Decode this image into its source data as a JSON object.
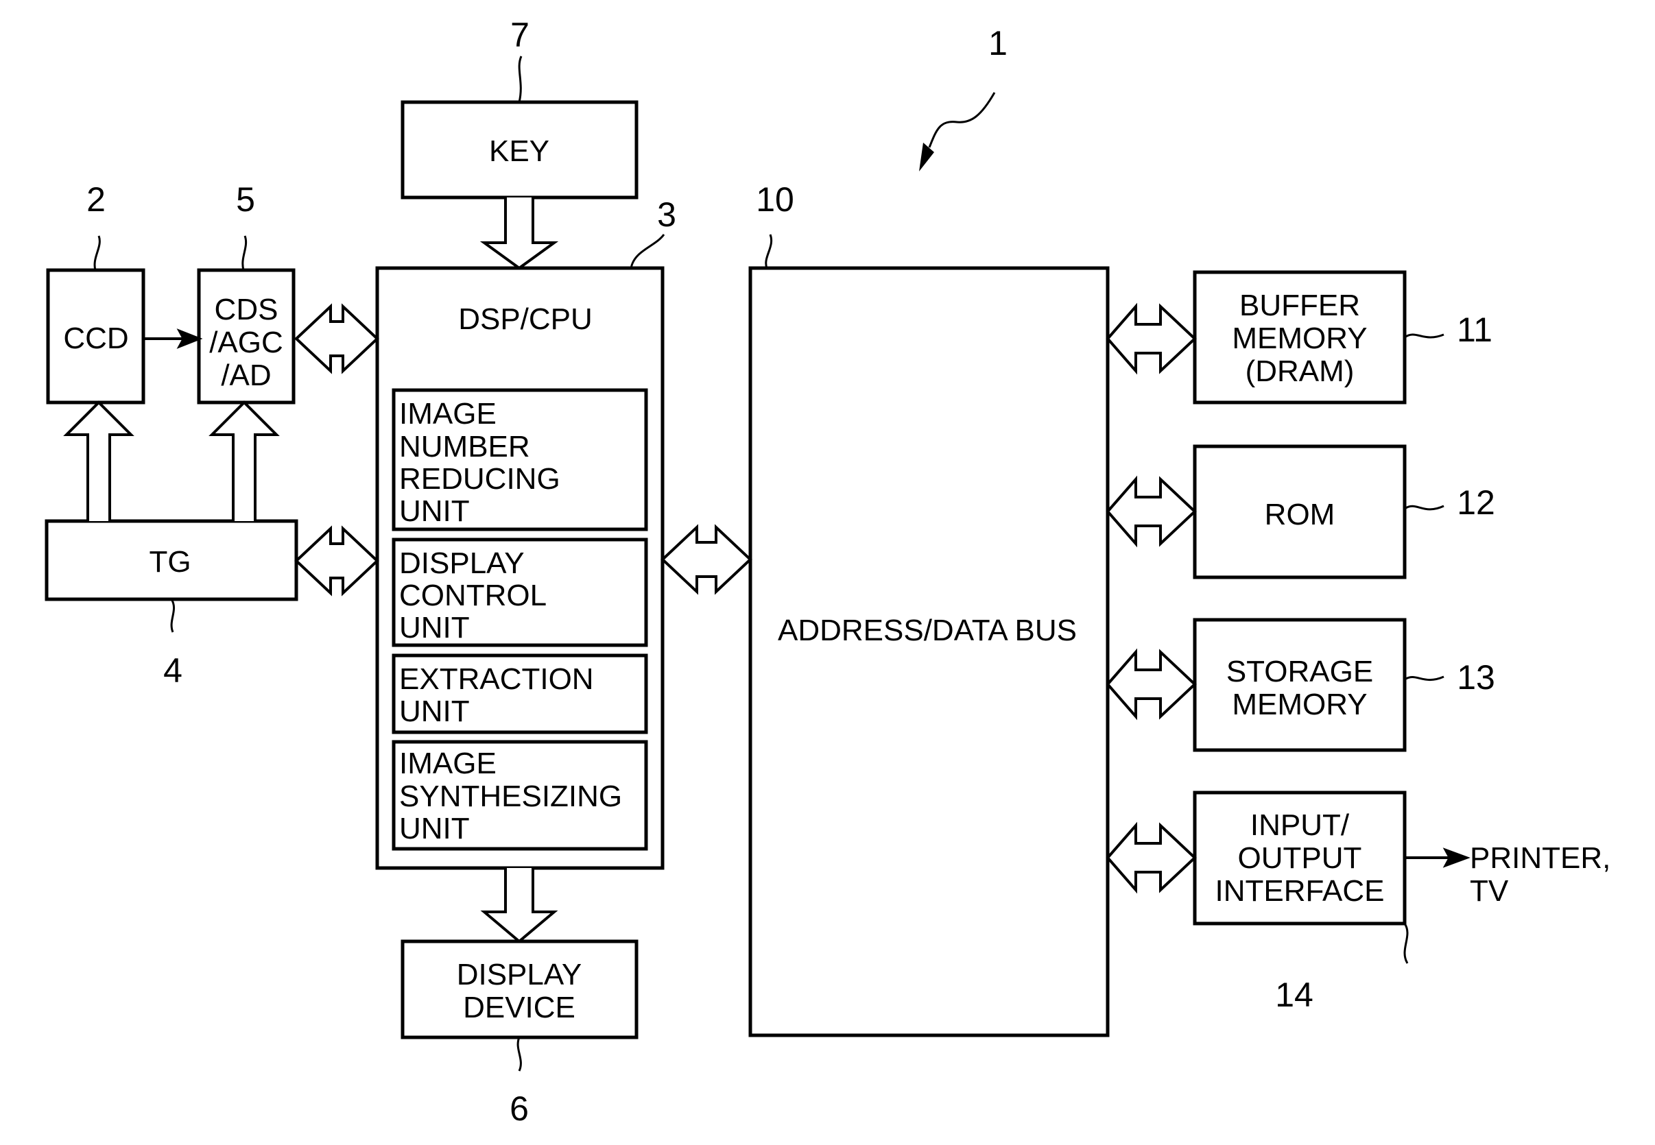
{
  "figure": {
    "ref": "1",
    "blocks": {
      "key": {
        "ref": "7",
        "lines": [
          "KEY"
        ]
      },
      "ccd": {
        "ref": "2",
        "lines": [
          "CCD"
        ]
      },
      "cds": {
        "ref": "5",
        "lines": [
          "CDS",
          "/AGC",
          "/AD"
        ]
      },
      "tg": {
        "ref": "4",
        "lines": [
          "TG"
        ]
      },
      "dsp": {
        "ref": "3",
        "lines": [
          "DSP/CPU"
        ]
      },
      "image_number": {
        "lines": [
          "IMAGE",
          "NUMBER",
          "REDUCING",
          "UNIT"
        ]
      },
      "display_control": {
        "lines": [
          "DISPLAY",
          "CONTROL",
          "UNIT"
        ]
      },
      "extraction": {
        "lines": [
          "EXTRACTION",
          "UNIT"
        ]
      },
      "image_synth": {
        "lines": [
          "IMAGE",
          "SYNTHESIZING",
          "UNIT"
        ]
      },
      "display_device": {
        "ref": "6",
        "lines": [
          "DISPLAY",
          "DEVICE"
        ]
      },
      "bus": {
        "ref": "10",
        "lines": [
          "ADDRESS/DATA BUS"
        ]
      },
      "buffer": {
        "ref": "11",
        "lines": [
          "BUFFER",
          "MEMORY",
          "(DRAM)"
        ]
      },
      "rom": {
        "ref": "12",
        "lines": [
          "ROM"
        ]
      },
      "storage": {
        "ref": "13",
        "lines": [
          "STORAGE",
          "MEMORY"
        ]
      },
      "io": {
        "ref": "14",
        "lines": [
          "INPUT/",
          "OUTPUT",
          "INTERFACE"
        ]
      }
    },
    "external": {
      "lines": [
        "PRINTER,",
        "TV"
      ]
    }
  }
}
